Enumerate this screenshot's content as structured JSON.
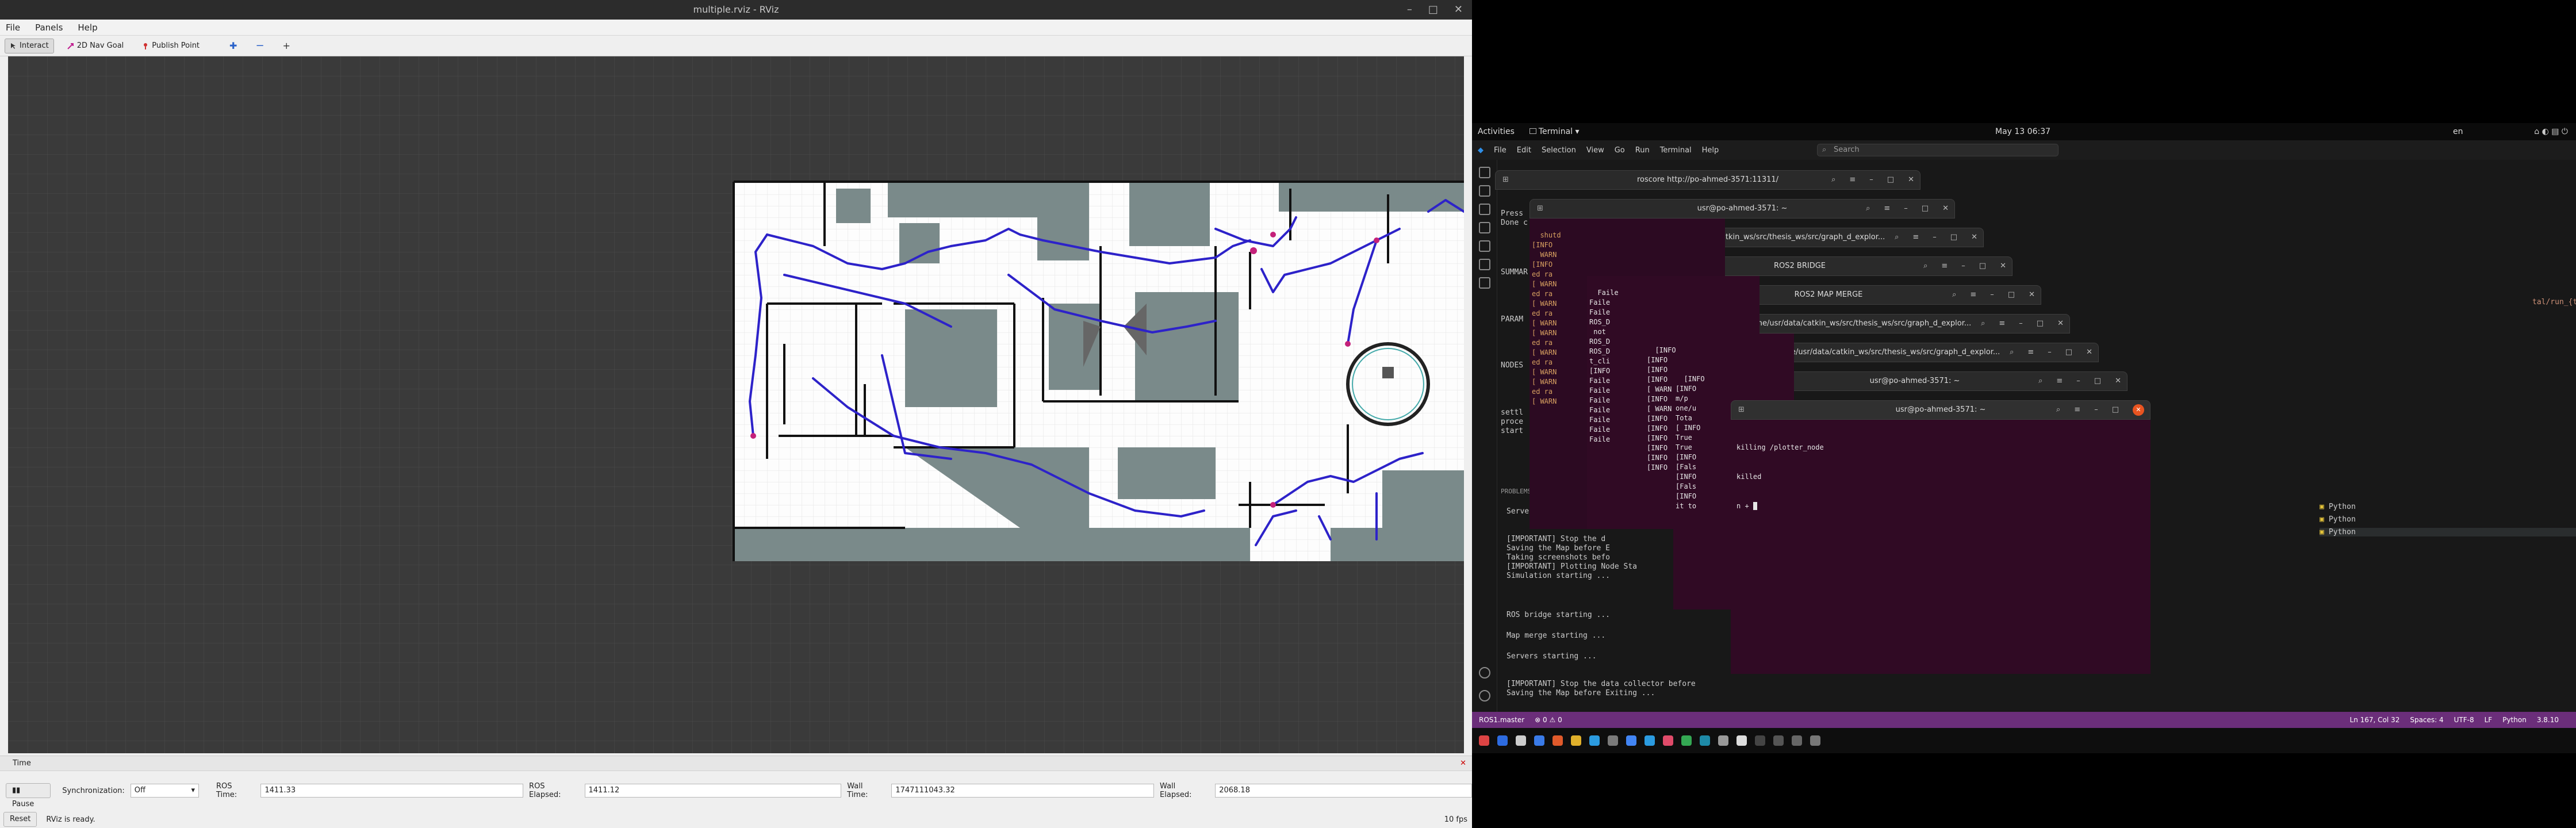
{
  "rviz": {
    "title": "multiple.rviz - RViz",
    "menu": [
      "File",
      "Panels",
      "Help"
    ],
    "tools": [
      {
        "label": "Interact",
        "icon": "cursor-icon"
      },
      {
        "label": "2D Nav Goal",
        "icon": "arrow-icon"
      },
      {
        "label": "Publish Point",
        "icon": "pin-icon"
      }
    ],
    "time_panel": {
      "title": "Time",
      "pause_label": "Pause",
      "sync_label": "Synchronization:",
      "sync_value": "Off",
      "ros_time_label": "ROS Time:",
      "ros_time": "1411.33",
      "ros_elapsed_label": "ROS Elapsed:",
      "ros_elapsed": "1411.12",
      "wall_time_label": "Wall Time:",
      "wall_time": "1747111043.32",
      "wall_elapsed_label": "Wall Elapsed:",
      "wall_elapsed": "2068.18"
    },
    "status": {
      "reset_label": "Reset",
      "message": "RViz is ready.",
      "fps": "10 fps"
    }
  },
  "gnome": {
    "activities": "Activities",
    "app": "Terminal",
    "clock": "May 13  06:37",
    "lang": "en"
  },
  "vscode": {
    "menu": [
      "File",
      "Edit",
      "Selection",
      "View",
      "Go",
      "Run",
      "Terminal",
      "Help"
    ],
    "search_placeholder": "Search",
    "editor_fragment": "tal/run_{timestamp}_{num_robots}_robots\"",
    "terminal_lines": [
      "Servers starting ...",
      "[IMPORTANT] Stop the d",
      "Saving the Map before E",
      "Taking screenshots befo",
      "[IMPORTANT] Plotting Node Sta",
      "Simulation starting ...",
      "ROS bridge starting ...",
      "Map merge starting ...",
      "Servers starting ...",
      "[IMPORTANT] Stop the data collector before",
      "Saving the Map before Exiting ..."
    ],
    "left_fragments": [
      "Press",
      "Done c",
      "SUMMAR",
      "PARAM",
      "NODES",
      "settl",
      "proce",
      "start",
      "PROBLEMS"
    ],
    "outline_items": [
      "Python",
      "Python",
      "Python"
    ],
    "status": {
      "branch": "ROS1.master",
      "errors": "0  ⚠ 0",
      "position": "Ln 167, Col 32",
      "spaces": "Spaces: 4",
      "encoding": "UTF-8",
      "eol": "LF",
      "language": "Python",
      "version": "3.8.10"
    }
  },
  "terminals": [
    {
      "title": "roscore http://po-ahmed-3571:11311/"
    },
    {
      "title": "usr@po-ahmed-3571: ~"
    },
    {
      "title": "/home/usr/data/catkin_ws/src/thesis_ws/src/graph_d_explor..."
    },
    {
      "title": "ROS2 BRIDGE"
    },
    {
      "title": "ROS2 MAP MERGE"
    },
    {
      "title": "/home/usr/data/catkin_ws/src/thesis_ws/src/graph_d_explor..."
    },
    {
      "title": "/home/usr/data/catkin_ws/src/thesis_ws/src/graph_d_explor..."
    },
    {
      "title": "usr@po-ahmed-3571: ~"
    },
    {
      "title": "usr@po-ahmed-3571: ~",
      "lines": [
        "killing /plotter_node",
        "killed",
        "n + "
      ]
    }
  ]
}
